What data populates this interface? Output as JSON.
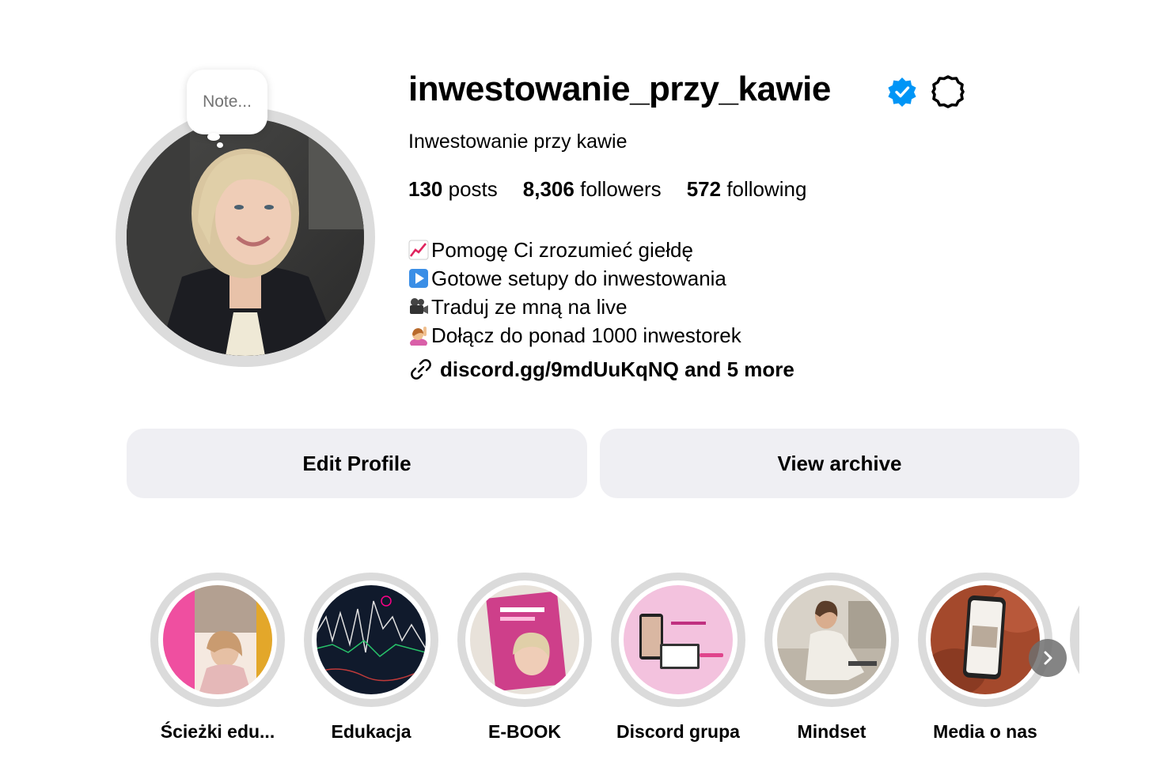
{
  "profile": {
    "note_placeholder": "Note...",
    "username": "inwestowanie_przy_kawie",
    "full_name": "Inwestowanie przy kawie",
    "stats": {
      "posts_count": "130",
      "posts_label": "posts",
      "followers_count": "8,306",
      "followers_label": "followers",
      "following_count": "572",
      "following_label": "following"
    },
    "bio": [
      {
        "icon": "chart-increasing-emoji",
        "text": "Pomogę Ci zrozumieć giełdę"
      },
      {
        "icon": "play-button-emoji",
        "text": "Gotowe setupy do inwestowania"
      },
      {
        "icon": "movie-camera-emoji",
        "text": "Traduj ze mną na live"
      },
      {
        "icon": "person-raising-hand-emoji",
        "text": "Dołącz do ponad 1000 inwestorek"
      }
    ],
    "link_text": "discord.gg/9mdUuKqNQ and 5 more"
  },
  "actions": {
    "edit_profile": "Edit Profile",
    "view_archive": "View archive"
  },
  "highlights": [
    {
      "label": "Ścieżki edu..."
    },
    {
      "label": "Edukacja"
    },
    {
      "label": "E-BOOK"
    },
    {
      "label": "Discord grupa"
    },
    {
      "label": "Mindset"
    },
    {
      "label": "Media o nas"
    }
  ],
  "colors": {
    "verified_blue": "#0095f6",
    "button_bg": "#efeff3",
    "ring_gray": "#dbdbdb"
  }
}
